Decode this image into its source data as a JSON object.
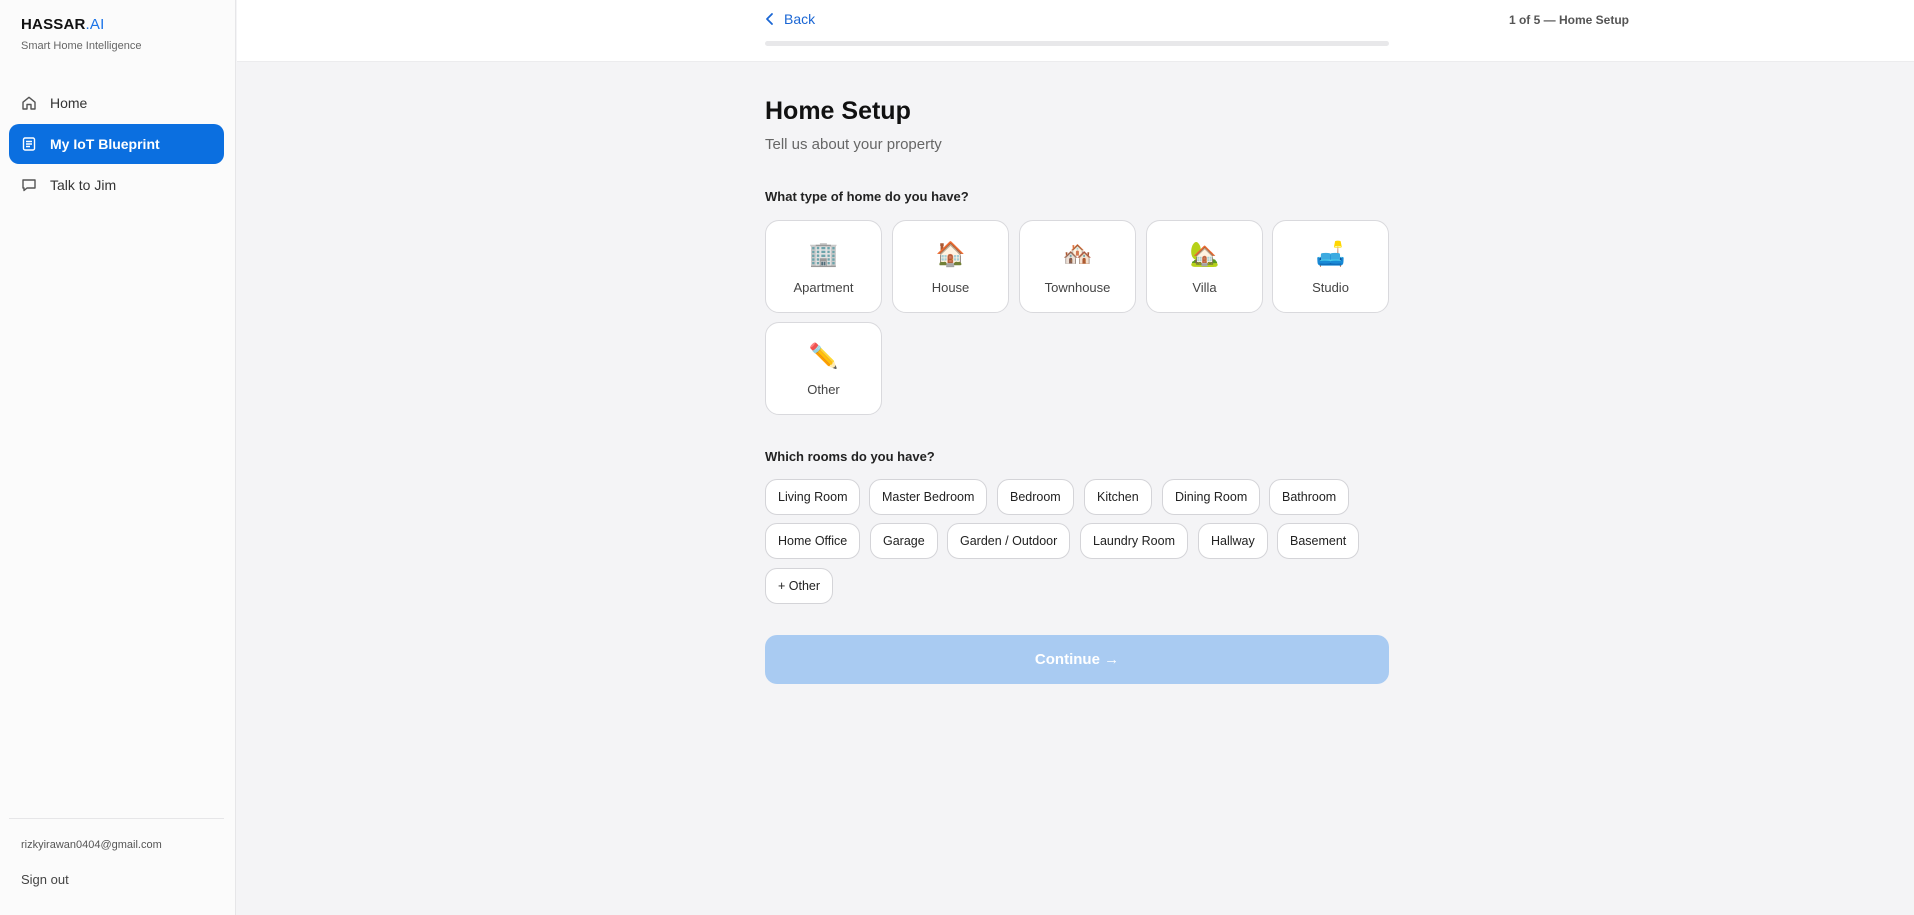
{
  "brand": {
    "name": "HASSAR",
    "suffix": ".AI",
    "tagline": "Smart Home Intelligence",
    "accent": "#1a73e8"
  },
  "sidebar": {
    "items": [
      {
        "label": "Home",
        "icon": "home-icon",
        "active": false
      },
      {
        "label": "My IoT Blueprint",
        "icon": "document-icon",
        "active": true
      },
      {
        "label": "Talk to Jim",
        "icon": "chat-icon",
        "active": false
      }
    ],
    "user_email": "rizkyirawan0404@gmail.com",
    "sign_out": "Sign out"
  },
  "topbar": {
    "back_label": "Back",
    "step_text": "1 of 5 — Home Setup",
    "progress_fraction": 0
  },
  "page": {
    "title": "Home Setup",
    "subtitle": "Tell us about your property",
    "home_type_question": "What type of home do you have?",
    "home_types": [
      {
        "emoji": "🏢",
        "label": "Apartment"
      },
      {
        "emoji": "🏠",
        "label": "House"
      },
      {
        "emoji": "🏘️",
        "label": "Townhouse"
      },
      {
        "emoji": "🏡",
        "label": "Villa"
      },
      {
        "emoji": "🛋️",
        "label": "Studio"
      },
      {
        "emoji": "✏️",
        "label": "Other"
      }
    ],
    "rooms_question": "Which rooms do you have?",
    "rooms": [
      "Living Room",
      "Master Bedroom",
      "Bedroom",
      "Kitchen",
      "Dining Room",
      "Bathroom",
      "Home Office",
      "Garage",
      "Garden / Outdoor",
      "Laundry Room",
      "Hallway",
      "Basement",
      "+ Other"
    ],
    "continue_label": "Continue →",
    "continue_disabled": true
  },
  "colors": {
    "primary": "#0b6fe0",
    "disabled_button": "#a9cbf2",
    "background": "#f4f4f6"
  }
}
